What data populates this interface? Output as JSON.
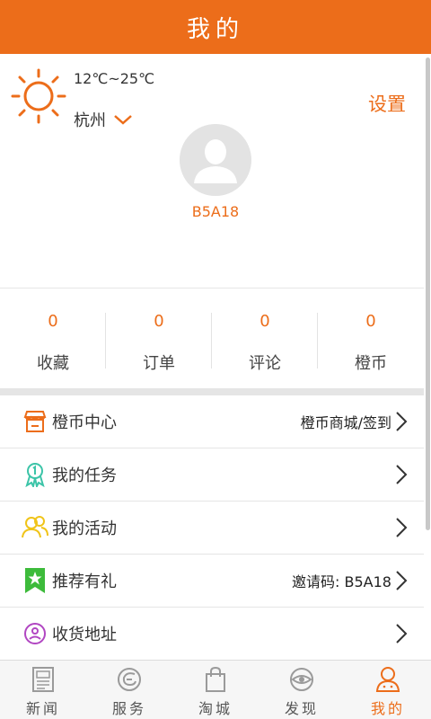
{
  "header": {
    "title": "我的"
  },
  "weather": {
    "temperature": "12℃~25℃",
    "city": "杭州",
    "icon": "sun-icon"
  },
  "settings_label": "设置",
  "user": {
    "name": "B5A18"
  },
  "stats": [
    {
      "value": "0",
      "label": "收藏"
    },
    {
      "value": "0",
      "label": "订单"
    },
    {
      "value": "0",
      "label": "评论"
    },
    {
      "value": "0",
      "label": "橙币"
    }
  ],
  "menu": [
    {
      "label": "橙币中心",
      "right": "橙币商城/签到",
      "icon": "shop-icon"
    },
    {
      "label": "我的任务",
      "right": "",
      "icon": "medal-icon"
    },
    {
      "label": "我的活动",
      "right": "",
      "icon": "people-icon"
    },
    {
      "label": "推荐有礼",
      "right": "邀请码: B5A18",
      "icon": "star-badge-icon"
    },
    {
      "label": "收货地址",
      "right": "",
      "icon": "address-icon"
    }
  ],
  "tabs": [
    {
      "label": "新闻",
      "icon": "news-icon"
    },
    {
      "label": "服务",
      "icon": "service-icon"
    },
    {
      "label": "淘城",
      "icon": "bag-icon"
    },
    {
      "label": "发现",
      "icon": "eye-icon"
    },
    {
      "label": "我的",
      "icon": "user-icon",
      "active": true
    }
  ],
  "colors": {
    "accent": "#ec6d1a",
    "divider": "#e5e5e5"
  }
}
